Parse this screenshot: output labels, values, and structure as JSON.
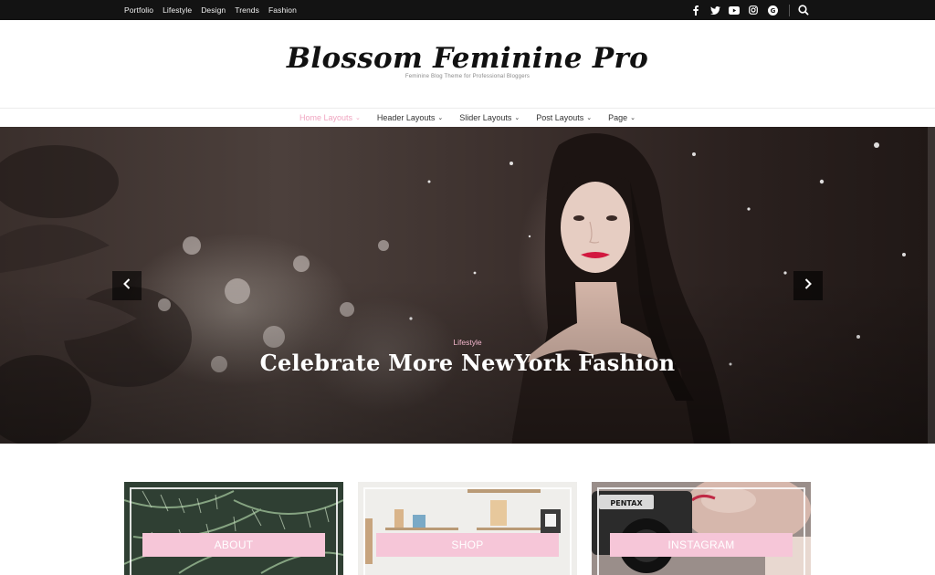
{
  "topbar": {
    "links": [
      "Portfolio",
      "Lifestyle",
      "Design",
      "Trends",
      "Fashion"
    ],
    "social_icons": [
      "facebook-icon",
      "twitter-icon",
      "youtube-icon",
      "instagram-icon",
      "google-plus-icon"
    ],
    "social_glyphs": [
      "f",
      "🐦",
      "▶",
      "◎",
      "G"
    ]
  },
  "header": {
    "title": "Blossom Feminine Pro",
    "tagline": "Feminine Blog Theme for Professional Bloggers"
  },
  "nav": {
    "items": [
      {
        "label": "Home Layouts",
        "active": true
      },
      {
        "label": "Header Layouts",
        "active": false
      },
      {
        "label": "Slider Layouts",
        "active": false
      },
      {
        "label": "Post Layouts",
        "active": false
      },
      {
        "label": "Page",
        "active": false
      }
    ]
  },
  "slider": {
    "category": "Lifestyle",
    "title": "Celebrate More NewYork Fashion"
  },
  "features": [
    {
      "label": "ABOUT"
    },
    {
      "label": "SHOP"
    },
    {
      "label": "INSTAGRAM"
    }
  ],
  "colors": {
    "accent_pink": "#f0a5c0",
    "button_pink": "#f6c6d8",
    "topbar_bg": "#131313"
  }
}
